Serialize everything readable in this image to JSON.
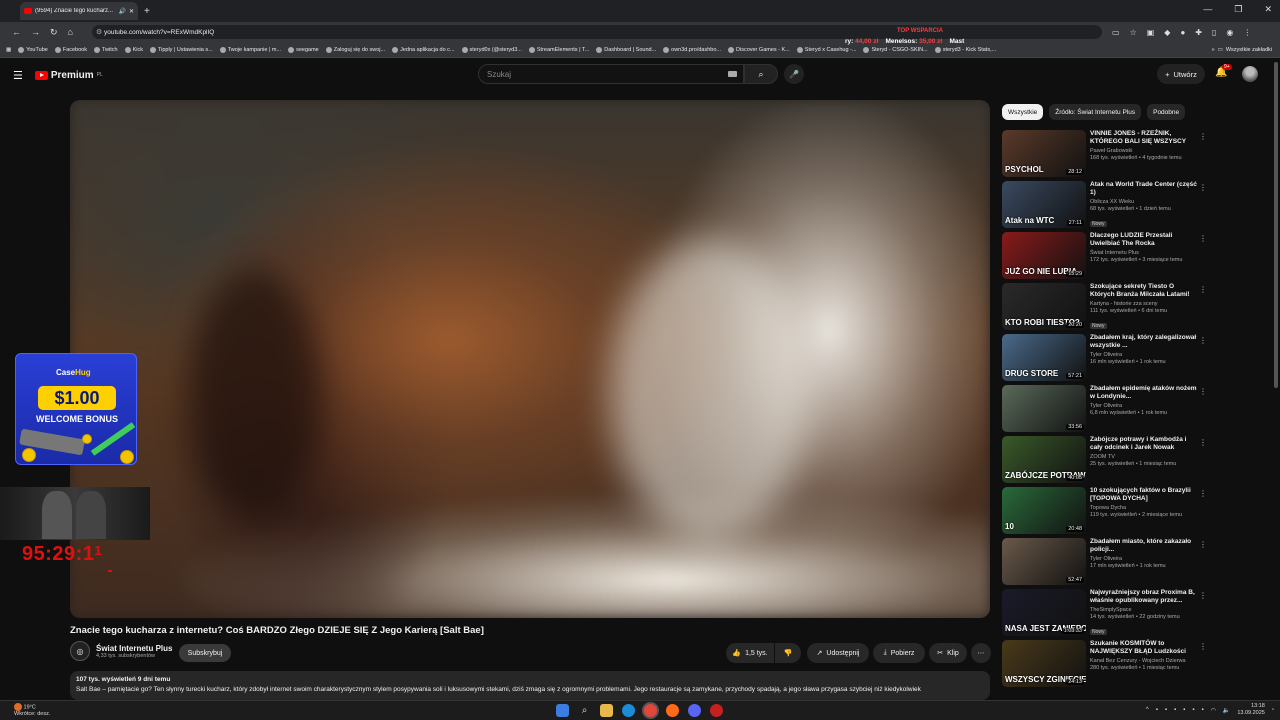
{
  "browser": {
    "tab_title": "(9594) Znacie tego kucharz...",
    "url": "youtube.com/watch?v=RExWmdKplIQ",
    "bookmarks": [
      "YouTube",
      "Facebook",
      "Twitch",
      "Kick",
      "Tipply | Ustawienia s...",
      "Twoje kampanie | m...",
      "seegame",
      "Zaloguj się do swoj...",
      "Jedna aplikacja do c...",
      "steryd0x (@steryd3...",
      "StreamElements | T...",
      "Dashboard | Sound...",
      "own3d.pro/dashbo...",
      "Discover Games - K...",
      "Steryd x Casehug -...",
      "Steryd - CSGO-SKIN...",
      "steryd3 - Kick Stats,..."
    ],
    "bookmarks_all": "Wszystkie zakładki"
  },
  "overlay": {
    "top_label": "TOP WSPARCIA",
    "ry_label": "ry:",
    "ry_value": "44,00 zł",
    "menelsos_label": "Menelsos:",
    "menelsos_value": "35,00 zł",
    "mast": "Mast"
  },
  "yt": {
    "logo": "Premium",
    "logo_sup": "PL",
    "search_placeholder": "Szukaj",
    "create": "Utwórz",
    "notif_count": "9+"
  },
  "video": {
    "title": "Znacie tego kucharza z internetu? Coś BARDZO Złego DZIEJE SIĘ Z Jego Karierą [Salt Bae]",
    "channel": "Świat Internetu Plus",
    "subs": "4,33 tys. subskrybentów",
    "subscribe": "Subskrybuj",
    "likes": "1,5 tys.",
    "share": "Udostępnij",
    "download": "Pobierz",
    "clip": "Klip",
    "desc_meta": "107 tys. wyświetleń  9 dni temu",
    "desc_text": "Salt Bae – pamiętacie go? Ten słynny turecki kucharz, który zdobył internet swoim charakterystycznym stylem posypywania soli i luksusowymi stekami, dziś zmaga się z ogromnymi problemami. Jego restauracje są zamykane, przychody spadają, a jego sława przygasa szybciej niż kiedykolwiek"
  },
  "ad": {
    "brand_a": "Case",
    "brand_b": "Hug",
    "amount": "$1.00",
    "bonus": "WELCOME BONUS"
  },
  "timer": {
    "value": "95:29:1",
    "sup": "1"
  },
  "chips": [
    "Wszystkie",
    "Źródło: Świat Internetu Plus",
    "Podobne"
  ],
  "related": [
    {
      "title": "VINNIE JONES - RZEŹNIK, KTÓREGO BALI SIĘ WSZYSCY",
      "channel": "Paweł Grabowski",
      "views": "168 tys. wyświetleń • 4 tygodnie temu",
      "duration": "28:12",
      "thumb_text": "PSYCHOL",
      "new": "",
      "bg": "#5a3a2a"
    },
    {
      "title": "Atak na World Trade Center (część 1)",
      "channel": "Oblicza XX Wieku",
      "views": "68 tys. wyświetleń • 1 dzień temu",
      "duration": "27:11",
      "thumb_text": "Atak na WTC",
      "new": "Nowy",
      "bg": "#3a4a60"
    },
    {
      "title": "Dlaczego LUDZIE Przestali Uwielbiać The Rocka",
      "channel": "Świat Internetu Plus",
      "views": "172 tys. wyświetleń • 3 miesiące temu",
      "duration": "15:29",
      "thumb_text": "JUŻ GO NIE LUBIĄ",
      "new": "",
      "bg": "#8a1a1a"
    },
    {
      "title": "Szokujące sekrety Tiesto O Których Branża Milczała Latami!",
      "channel": "Kartyna - historie zza sceny",
      "views": "111 tys. wyświetleń • 6 dni temu",
      "duration": "20:20",
      "thumb_text": "KTO ROBI TIESTO?",
      "new": "Nowy",
      "bg": "#2a2a2a"
    },
    {
      "title": "Zbadałem kraj, który zalegalizował wszystkie ...",
      "channel": "Tyler Oliveira",
      "views": "16 mln wyświetleń • 1 rok temu",
      "duration": "57:21",
      "thumb_text": "DRUG STORE",
      "new": "",
      "bg": "#4a6a8a"
    },
    {
      "title": "Zbadałem epidemię ataków nożem w Londynie...",
      "channel": "Tyler Oliveira",
      "views": "6,8 mln wyświetleń • 1 rok temu",
      "duration": "33:56",
      "thumb_text": "",
      "new": "",
      "bg": "#5a6a5a"
    },
    {
      "title": "Zabójcze potrawy i Kambodża i cały odcinek i Jarek Nowak",
      "channel": "ZOOM TV",
      "views": "25 tys. wyświetleń • 1 miesiąc temu",
      "duration": "40:05",
      "thumb_text": "ZABÓJCZE POTRAWY",
      "new": "",
      "bg": "#3a5a2a"
    },
    {
      "title": "10 szokujących faktów o Brazylii [TOPOWA DYCHA]",
      "channel": "Topowa Dycha",
      "views": "119 tys. wyświetleń • 2 miesiące temu",
      "duration": "20:48",
      "thumb_text": "10",
      "new": "",
      "bg": "#2a6a3a"
    },
    {
      "title": "Zbadałem miasto, które zakazało policji...",
      "channel": "Tyler Oliveira",
      "views": "17 mln wyświetleń • 1 rok temu",
      "duration": "52:47",
      "thumb_text": "",
      "new": "",
      "bg": "#6a5a4a"
    },
    {
      "title": "Najwyraźniejszy obraz Proxima B, właśnie opublikowany przez...",
      "channel": "TheSimplySpace",
      "views": "14 tys. wyświetleń • 22 godziny temu",
      "duration": "1:03:33",
      "thumb_text": "NASA JEST ZANIEPO",
      "new": "Nowy",
      "bg": "#1a1a2a"
    },
    {
      "title": "Szukanie KOSMITÓW to NAJWIĘKSZY BŁĄD Ludzkości",
      "channel": "Kanał Bez Cenzury - Wojciech Dzierwa",
      "views": "280 tys. wyświetleń • 1 miesiąc temu",
      "duration": "24:13",
      "thumb_text": "WSZYSCY ZGINIECIE.",
      "new": "",
      "bg": "#4a3a1a"
    }
  ],
  "taskbar": {
    "temp": "19°C",
    "weather_text": "Wkrótce: desz.",
    "time": "13:18",
    "date": "13.09.2025"
  }
}
